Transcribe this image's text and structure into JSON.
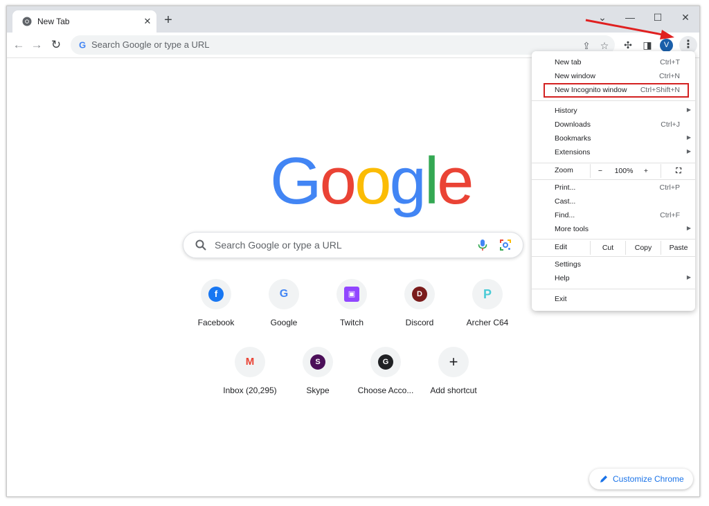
{
  "tab": {
    "title": "New Tab",
    "close": "✕"
  },
  "new_tab_button": "+",
  "window_controls": {
    "dropdown": "⌄",
    "minimize": "—",
    "maximize": "☐",
    "close": "✕"
  },
  "omnibox": {
    "placeholder": "Search Google or type a URL"
  },
  "avatar_letter": "V",
  "logo": {
    "letters": [
      "G",
      "o",
      "o",
      "g",
      "l",
      "e"
    ],
    "colors": [
      "#4285F4",
      "#EA4335",
      "#FBBC05",
      "#4285F4",
      "#34A853",
      "#EA4335"
    ]
  },
  "search": {
    "placeholder": "Search Google or type a URL"
  },
  "shortcuts": [
    {
      "label": "Facebook",
      "icon": "facebook-icon",
      "glyph": "f",
      "color": "#1877F2"
    },
    {
      "label": "Google",
      "icon": "google-icon",
      "glyph": "G",
      "color": "#4285F4"
    },
    {
      "label": "Twitch",
      "icon": "twitch-icon",
      "glyph": "▣",
      "color": "#9146FF"
    },
    {
      "label": "Discord",
      "icon": "discord-icon",
      "glyph": "D",
      "color": "#7a1c1c"
    },
    {
      "label": "Archer C64",
      "icon": "tplink-icon",
      "glyph": "P",
      "color": "#4acbd6"
    },
    {
      "label": "Inbox (20,295)",
      "icon": "gmail-icon",
      "glyph": "M",
      "color": "#EA4335"
    },
    {
      "label": "Skype",
      "icon": "skype-icon",
      "glyph": "S",
      "color": "#4b0f59"
    },
    {
      "label": "Choose Acco...",
      "icon": "google-account-icon",
      "glyph": "G",
      "color": "#202124"
    },
    {
      "label": "Add shortcut",
      "icon": "plus-icon",
      "glyph": "+",
      "color": "#202124"
    }
  ],
  "customize": {
    "label": "Customize Chrome"
  },
  "menu": {
    "new_tab": {
      "label": "New tab",
      "shortcut": "Ctrl+T"
    },
    "new_window": {
      "label": "New window",
      "shortcut": "Ctrl+N"
    },
    "new_incognito": {
      "label": "New Incognito window",
      "shortcut": "Ctrl+Shift+N"
    },
    "history": {
      "label": "History"
    },
    "downloads": {
      "label": "Downloads",
      "shortcut": "Ctrl+J"
    },
    "bookmarks": {
      "label": "Bookmarks"
    },
    "extensions": {
      "label": "Extensions"
    },
    "zoom": {
      "label": "Zoom",
      "minus": "−",
      "value": "100%",
      "plus": "+"
    },
    "print": {
      "label": "Print...",
      "shortcut": "Ctrl+P"
    },
    "cast": {
      "label": "Cast..."
    },
    "find": {
      "label": "Find...",
      "shortcut": "Ctrl+F"
    },
    "more_tools": {
      "label": "More tools"
    },
    "edit": {
      "label": "Edit",
      "cut": "Cut",
      "copy": "Copy",
      "paste": "Paste"
    },
    "settings": {
      "label": "Settings"
    },
    "help": {
      "label": "Help"
    },
    "exit": {
      "label": "Exit"
    }
  },
  "accent_colors": {
    "annotation_red": "#d32020",
    "link_blue": "#1a73e8"
  }
}
